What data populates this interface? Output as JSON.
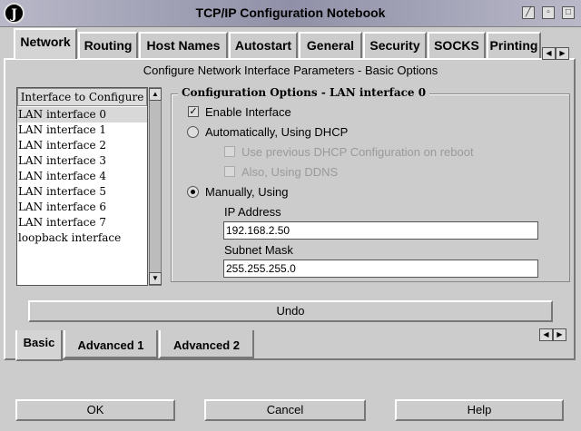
{
  "window": {
    "title": "TCP/IP Configuration Notebook",
    "icon_letter": "J"
  },
  "tabs": [
    "Network",
    "Routing",
    "Host Names",
    "Autostart",
    "General",
    "Security",
    "SOCKS",
    "Printing"
  ],
  "page": {
    "subtitle": "Configure Network Interface Parameters - Basic Options"
  },
  "interfaces": {
    "header": "Interface to Configure",
    "items": [
      "LAN interface 0",
      "LAN interface 1",
      "LAN interface 2",
      "LAN interface 3",
      "LAN interface 4",
      "LAN interface 5",
      "LAN interface 6",
      "LAN interface 7",
      "loopback interface"
    ],
    "selected_index": 0
  },
  "config": {
    "group_title": "Configuration Options - LAN interface 0",
    "enable_interface": "Enable Interface",
    "enable_interface_checked": true,
    "auto_dhcp": "Automatically, Using DHCP",
    "use_previous_dhcp": "Use previous DHCP Configuration on reboot",
    "using_ddns": "Also, Using DDNS",
    "manual": "Manually, Using",
    "manual_selected": true,
    "ip_label": "IP Address",
    "ip_value": "192.168.2.50",
    "subnet_label": "Subnet Mask",
    "subnet_value": "255.255.255.0"
  },
  "undo_label": "Undo",
  "subtabs": [
    "Basic",
    "Advanced 1",
    "Advanced 2"
  ],
  "buttons": {
    "ok": "OK",
    "cancel": "Cancel",
    "help": "Help"
  }
}
